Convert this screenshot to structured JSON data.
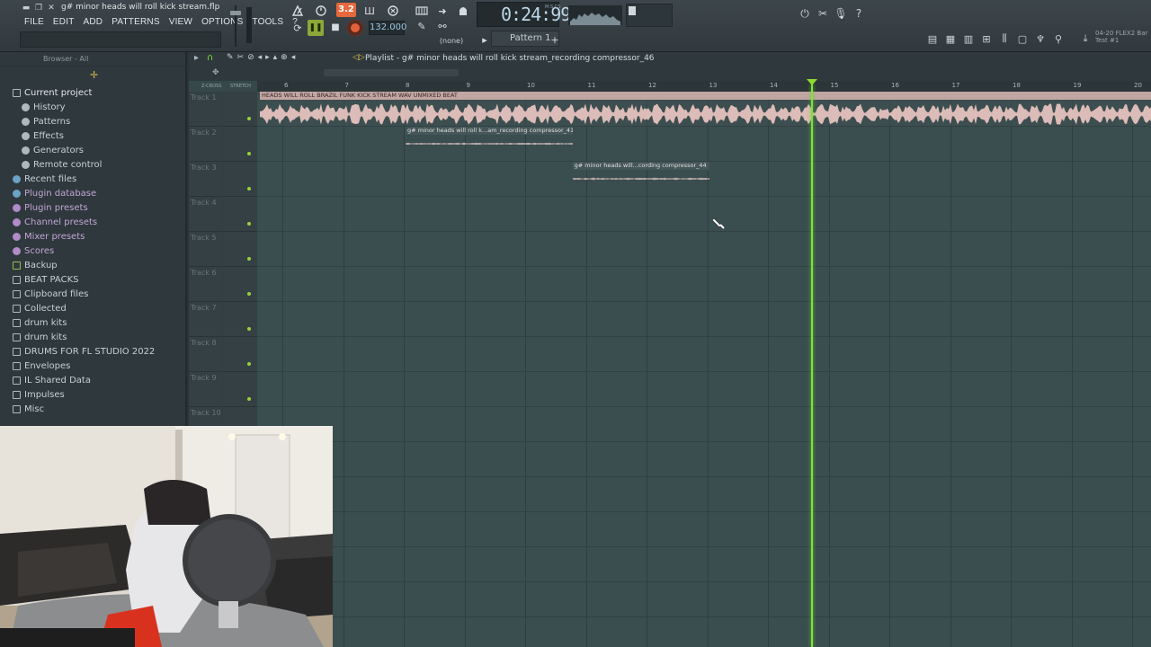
{
  "titlebar": {
    "filename": "g# minor heads will roll kick stream.flp"
  },
  "menu": [
    "FILE",
    "EDIT",
    "ADD",
    "PATTERNS",
    "VIEW",
    "OPTIONS",
    "TOOLS",
    "?"
  ],
  "transport": {
    "pat_song_label": "3.2",
    "tempo": "132.000",
    "time": "0:24:99",
    "time_unit": "M:S:CS",
    "snap": "(none)",
    "pattern": "Pattern 1"
  },
  "news": {
    "line1": "04-20  FLEX2 Bar",
    "line2": "Test #1"
  },
  "browser": {
    "header": "Browser - All",
    "items": [
      {
        "label": "Current project",
        "indent": 0,
        "color": "#e4eaed",
        "icon": "folder-open"
      },
      {
        "label": "History",
        "indent": 1,
        "color": "#c6d1d6",
        "icon": "history"
      },
      {
        "label": "Patterns",
        "indent": 1,
        "color": "#c6d1d6",
        "icon": "pattern"
      },
      {
        "label": "Effects",
        "indent": 1,
        "color": "#c6d1d6",
        "icon": "effect"
      },
      {
        "label": "Generators",
        "indent": 1,
        "color": "#c6d1d6",
        "icon": "generator"
      },
      {
        "label": "Remote control",
        "indent": 1,
        "color": "#c6d1d6",
        "icon": "remote"
      },
      {
        "label": "Recent files",
        "indent": 0,
        "color": "#c6d1d6",
        "icon": "recent"
      },
      {
        "label": "Plugin database",
        "indent": 0,
        "color": "#c2a6d6",
        "icon": "plugin-db"
      },
      {
        "label": "Plugin presets",
        "indent": 0,
        "color": "#c2a6d6",
        "icon": "plugin-preset"
      },
      {
        "label": "Channel presets",
        "indent": 0,
        "color": "#c2a6d6",
        "icon": "channel-preset"
      },
      {
        "label": "Mixer presets",
        "indent": 0,
        "color": "#c2a6d6",
        "icon": "mixer-preset"
      },
      {
        "label": "Scores",
        "indent": 0,
        "color": "#c2a6d6",
        "icon": "score"
      },
      {
        "label": "Backup",
        "indent": 0,
        "color": "#c6d1d6",
        "icon": "backup"
      },
      {
        "label": "BEAT PACKS",
        "indent": 0,
        "color": "#c6d1d6",
        "icon": "folder"
      },
      {
        "label": "Clipboard files",
        "indent": 0,
        "color": "#c6d1d6",
        "icon": "folder"
      },
      {
        "label": "Collected",
        "indent": 0,
        "color": "#c6d1d6",
        "icon": "folder"
      },
      {
        "label": "drum kits",
        "indent": 0,
        "color": "#c6d1d6",
        "icon": "folder"
      },
      {
        "label": "drum kits",
        "indent": 0,
        "color": "#c6d1d6",
        "icon": "folder"
      },
      {
        "label": "DRUMS FOR FL STUDIO 2022",
        "indent": 0,
        "color": "#c6d1d6",
        "icon": "folder"
      },
      {
        "label": "Envelopes",
        "indent": 0,
        "color": "#c6d1d6",
        "icon": "folder"
      },
      {
        "label": "IL Shared Data",
        "indent": 0,
        "color": "#c6d1d6",
        "icon": "folder"
      },
      {
        "label": "Impulses",
        "indent": 0,
        "color": "#c6d1d6",
        "icon": "folder"
      },
      {
        "label": "Misc",
        "indent": 0,
        "color": "#c6d1d6",
        "icon": "folder"
      }
    ]
  },
  "playlist": {
    "title": "Playlist - g# minor heads will roll kick stream_recording compressor_46",
    "toolbar_labels": {
      "mode_a": "Z-CROSS",
      "mode_b": "STRETCH"
    },
    "ruler": [
      "6",
      "7",
      "8",
      "9",
      "10",
      "11",
      "12",
      "13",
      "14",
      "15",
      "16",
      "17",
      "18",
      "19",
      "20"
    ],
    "tracks": [
      "Track 1",
      "Track 2",
      "Track 3",
      "Track 4",
      "Track 5",
      "Track 6",
      "Track 7",
      "Track 8",
      "Track 9",
      "Track 10"
    ],
    "clips": [
      {
        "title": "HEADS WILL ROLL BRAZIL FUNK KICK STREAM WAV UNMIXED BEAT",
        "track": 1,
        "start_bar": 5.6,
        "end_bar": 20.3,
        "color": "#d8b6b2"
      },
      {
        "title": "g# minor heads will roll k...am_recording compressor_41",
        "track": 2,
        "start_bar": 8.0,
        "end_bar": 10.75,
        "color": "#c9a7a4"
      },
      {
        "title": "g# minor heads will...cording compressor_44",
        "track": 3,
        "start_bar": 10.75,
        "end_bar": 13.0,
        "color": "#c9a7a4"
      }
    ],
    "playhead_bar": 14.7,
    "colors": {
      "grid": "#3a4d4f",
      "playhead": "#7fe23a",
      "clip_audio": "#d8b6b2"
    }
  }
}
